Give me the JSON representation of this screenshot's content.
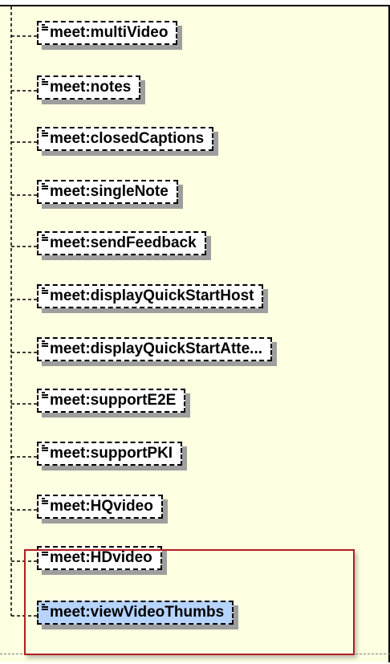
{
  "nodes": [
    {
      "label": "meet:multiVideo"
    },
    {
      "label": "meet:notes"
    },
    {
      "label": "meet:closedCaptions"
    },
    {
      "label": "meet:singleNote"
    },
    {
      "label": "meet:sendFeedback"
    },
    {
      "label": "meet:displayQuickStartHost"
    },
    {
      "label": "meet:displayQuickStartAtte..."
    },
    {
      "label": "meet:supportE2E"
    },
    {
      "label": "meet:supportPKI"
    },
    {
      "label": "meet:HQvideo"
    },
    {
      "label": "meet:HDvideo"
    },
    {
      "label": "meet:viewVideoThumbs",
      "selected": true
    }
  ],
  "colors": {
    "panel_background": "#ffffe1",
    "node_background": "#ffffff",
    "selected_node_background": "#b7d4ff",
    "highlight_border": "#b21f1f"
  },
  "icons": {
    "node_icon": "element-icon"
  }
}
